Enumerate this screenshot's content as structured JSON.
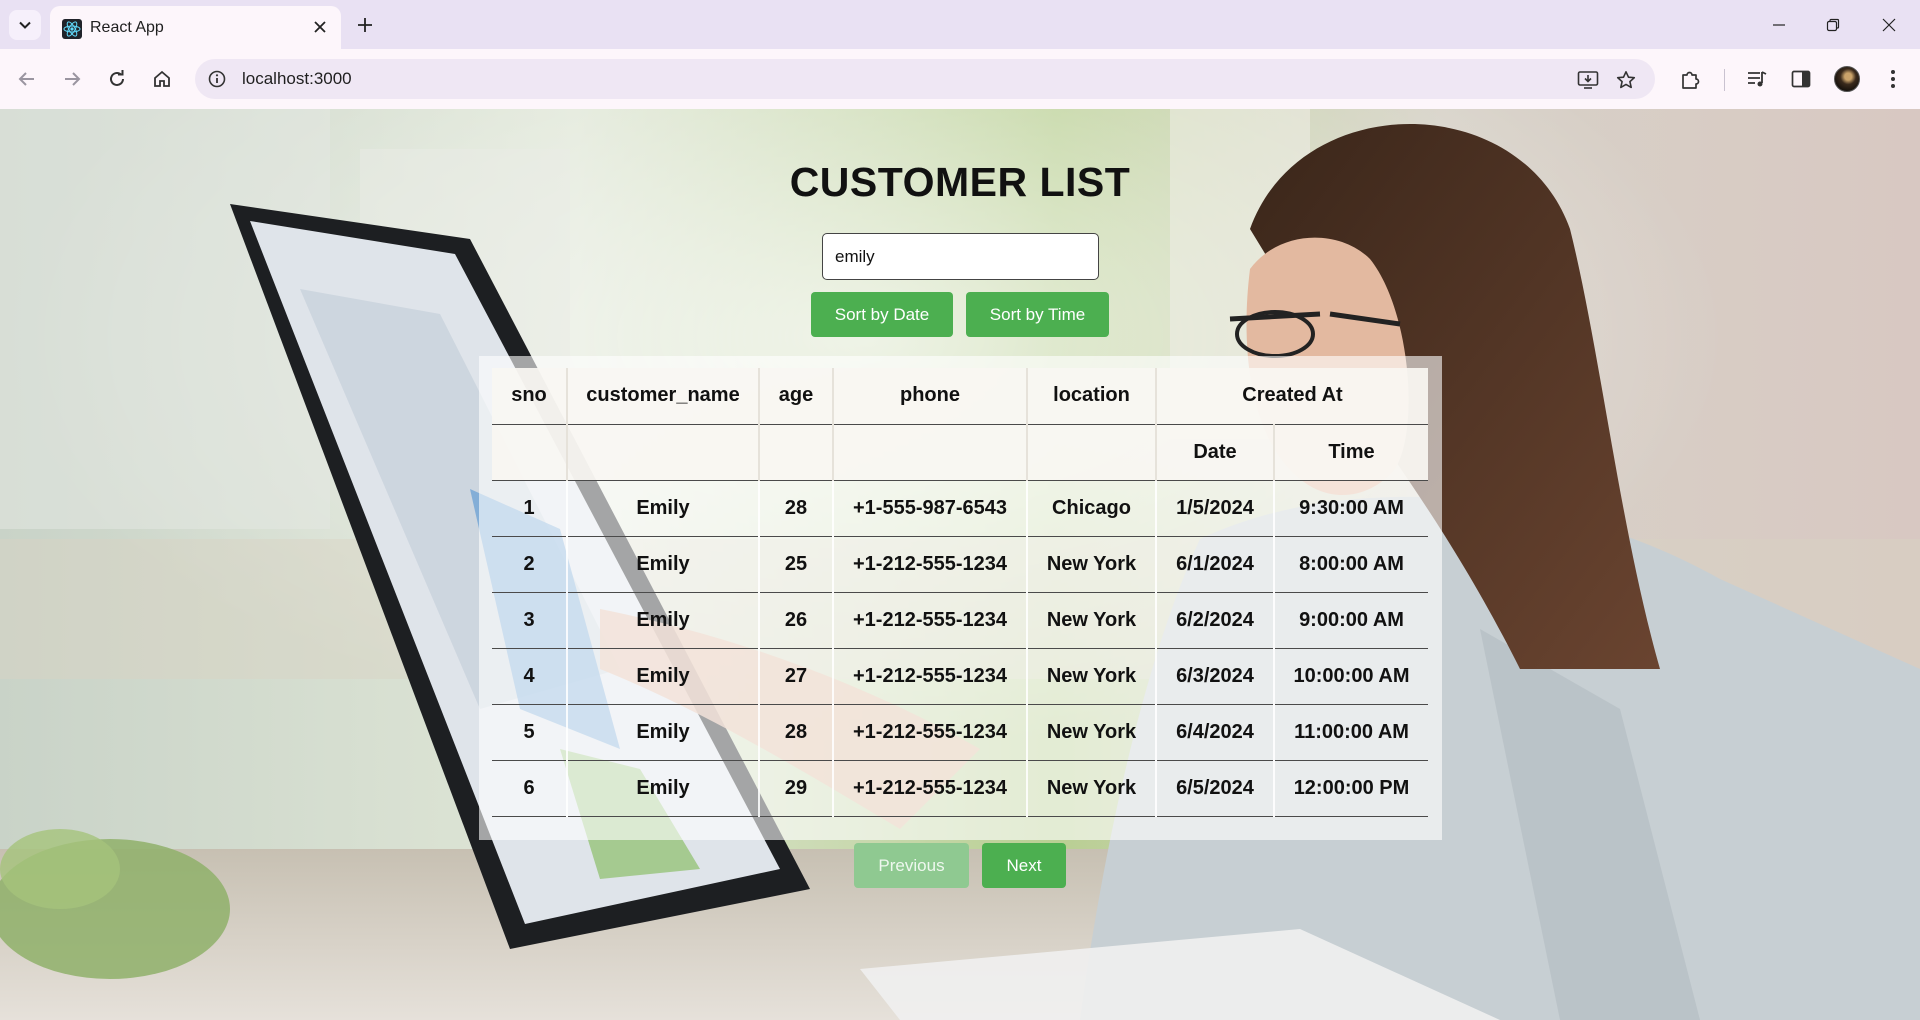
{
  "browser": {
    "tab_title": "React App",
    "url": "localhost:3000"
  },
  "icons": {
    "tab_list": "chevron-down-icon",
    "favicon": "react-logo-icon",
    "tab_close": "close-icon",
    "new_tab": "plus-icon",
    "minimize": "minimize-icon",
    "restore": "restore-icon",
    "close_window": "close-icon",
    "back": "arrow-left-icon",
    "forward": "arrow-right-icon",
    "reload": "reload-icon",
    "home": "home-icon",
    "site_info": "info-icon",
    "install": "install-app-icon",
    "bookmark": "star-icon",
    "extensions": "puzzle-icon",
    "media": "media-control-icon",
    "side_panel": "side-panel-icon",
    "profile": "avatar",
    "menu": "kebab-menu-icon"
  },
  "colors": {
    "accent_green": "#4caf50",
    "disabled_green": "#8fc991"
  },
  "page": {
    "title": "CUSTOMER LIST",
    "search_value": "emily",
    "sort_date_label": "Sort by Date",
    "sort_time_label": "Sort by Time",
    "prev_label": "Previous",
    "next_label": "Next"
  },
  "table": {
    "columns": [
      "sno",
      "customer_name",
      "age",
      "phone",
      "location",
      "Created At"
    ],
    "sub_columns": [
      "Date",
      "Time"
    ],
    "rows": [
      {
        "sno": "1",
        "name": "Emily",
        "age": "28",
        "phone": "+1-555-987-6543",
        "location": "Chicago",
        "date": "1/5/2024",
        "time": "9:30:00 AM"
      },
      {
        "sno": "2",
        "name": "Emily",
        "age": "25",
        "phone": "+1-212-555-1234",
        "location": "New York",
        "date": "6/1/2024",
        "time": "8:00:00 AM"
      },
      {
        "sno": "3",
        "name": "Emily",
        "age": "26",
        "phone": "+1-212-555-1234",
        "location": "New York",
        "date": "6/2/2024",
        "time": "9:00:00 AM"
      },
      {
        "sno": "4",
        "name": "Emily",
        "age": "27",
        "phone": "+1-212-555-1234",
        "location": "New York",
        "date": "6/3/2024",
        "time": "10:00:00 AM"
      },
      {
        "sno": "5",
        "name": "Emily",
        "age": "28",
        "phone": "+1-212-555-1234",
        "location": "New York",
        "date": "6/4/2024",
        "time": "11:00:00 AM"
      },
      {
        "sno": "6",
        "name": "Emily",
        "age": "29",
        "phone": "+1-212-555-1234",
        "location": "New York",
        "date": "6/5/2024",
        "time": "12:00:00 PM"
      }
    ]
  }
}
